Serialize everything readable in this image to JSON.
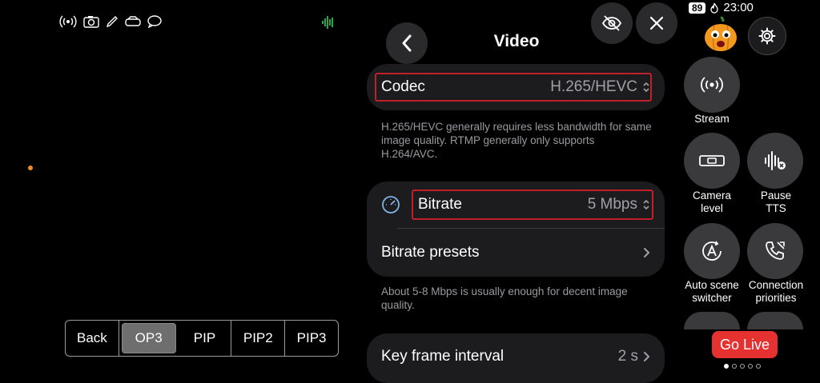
{
  "status_icons": [
    "stream-signal-icon",
    "camera-icon",
    "pen-icon",
    "cloud-icon",
    "chat-icon"
  ],
  "panel": {
    "title": "Video",
    "codec": {
      "label": "Codec",
      "value": "H.265/HEVC"
    },
    "codec_description": "H.265/HEVC generally requires less bandwidth for same image quality. RTMP generally only supports H.264/AVC.",
    "bitrate": {
      "label": "Bitrate",
      "value": "5 Mbps"
    },
    "bitrate_presets": {
      "label": "Bitrate presets"
    },
    "bitrate_description": "About 5-8 Mbps is usually enough for decent image quality.",
    "key_frame": {
      "label": "Key frame interval",
      "value": "2 s"
    }
  },
  "scenes": {
    "items": [
      "Back",
      "OP3",
      "PIP",
      "PIP2",
      "PIP3"
    ],
    "selected": "OP3"
  },
  "status_bar": {
    "battery": "89",
    "time": "23:00"
  },
  "quick_actions": {
    "stream": "Stream",
    "camera_level": "Camera level",
    "pause_tts": "Pause TTS",
    "auto_scene": "Auto scene switcher",
    "connection": "Connection priorities"
  },
  "go_live": "Go Live",
  "colors": {
    "accent_red": "#c0202a",
    "go_live": "#e5312f",
    "orange_dot": "#f08a24",
    "audio_green": "#2fd15a"
  }
}
